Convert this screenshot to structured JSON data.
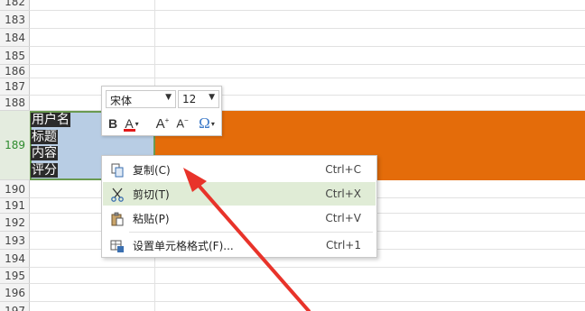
{
  "spreadsheet": {
    "rows": [
      "182",
      "183",
      "184",
      "185",
      "186",
      "187",
      "188",
      "189",
      "190",
      "191",
      "192",
      "193",
      "194",
      "195",
      "196",
      "197"
    ],
    "active_row": "189",
    "cell_lines": [
      "用户名",
      "标题",
      "内容",
      "评分"
    ],
    "fill_color": "#e46c0a",
    "selected_cell_color": "#b8cde4"
  },
  "mini_toolbar": {
    "font_name": "宋体",
    "font_size": "12",
    "bold_label": "B",
    "font_color_label": "A",
    "font_color": "#e21a1a",
    "grow_font_label": "A",
    "shrink_font_label": "A",
    "symbol_label": "Ω"
  },
  "context_menu": {
    "items": [
      {
        "label": "复制(C)",
        "shortcut": "Ctrl+C",
        "icon": "copy-icon"
      },
      {
        "label": "剪切(T)",
        "shortcut": "Ctrl+X",
        "icon": "scissors-icon"
      },
      {
        "label": "粘贴(P)",
        "shortcut": "Ctrl+V",
        "icon": "clipboard-icon"
      },
      {
        "label": "设置单元格格式(F)...",
        "shortcut": "Ctrl+1",
        "icon": "format-cells-icon"
      }
    ],
    "highlight_color": "#e0ecd6"
  },
  "annotation": {
    "arrow_color": "#e8332a",
    "arrow_icon": "red-arrow-annotation"
  }
}
